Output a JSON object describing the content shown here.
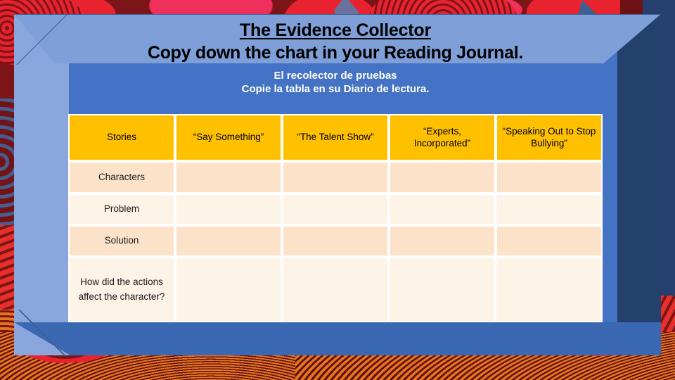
{
  "slide": {
    "title": "The Evidence Collector",
    "subtitle": "Copy down the chart in your Reading Journal.",
    "title_es": "El recolector de pruebas",
    "subtitle_es": "Copie la tabla en su Diario de lectura."
  },
  "colors": {
    "panel_blue": "#4472C4",
    "bevel_light": "#8AA6DC",
    "bevel_top": "#7F9FD8",
    "bevel_dark": "#24406D",
    "header_gold": "#FFC000",
    "row_peach": "#FBE2C8",
    "row_cream": "#FDF3E6",
    "grid_white": "#FFFFFF",
    "background_red": "#6E1216"
  },
  "table": {
    "headers": [
      "Stories",
      "“Say Something”",
      "“The Talent Show”",
      "“Experts, Incorporated”",
      "“Speaking Out to Stop Bullying”"
    ],
    "rows": [
      {
        "label": "Characters",
        "cells": [
          "",
          "",
          "",
          ""
        ]
      },
      {
        "label": "Problem",
        "cells": [
          "",
          "",
          "",
          ""
        ]
      },
      {
        "label": "Solution",
        "cells": [
          "",
          "",
          "",
          ""
        ]
      },
      {
        "label": "How did the actions affect the character?",
        "cells": [
          "",
          "",
          "",
          ""
        ]
      }
    ]
  }
}
